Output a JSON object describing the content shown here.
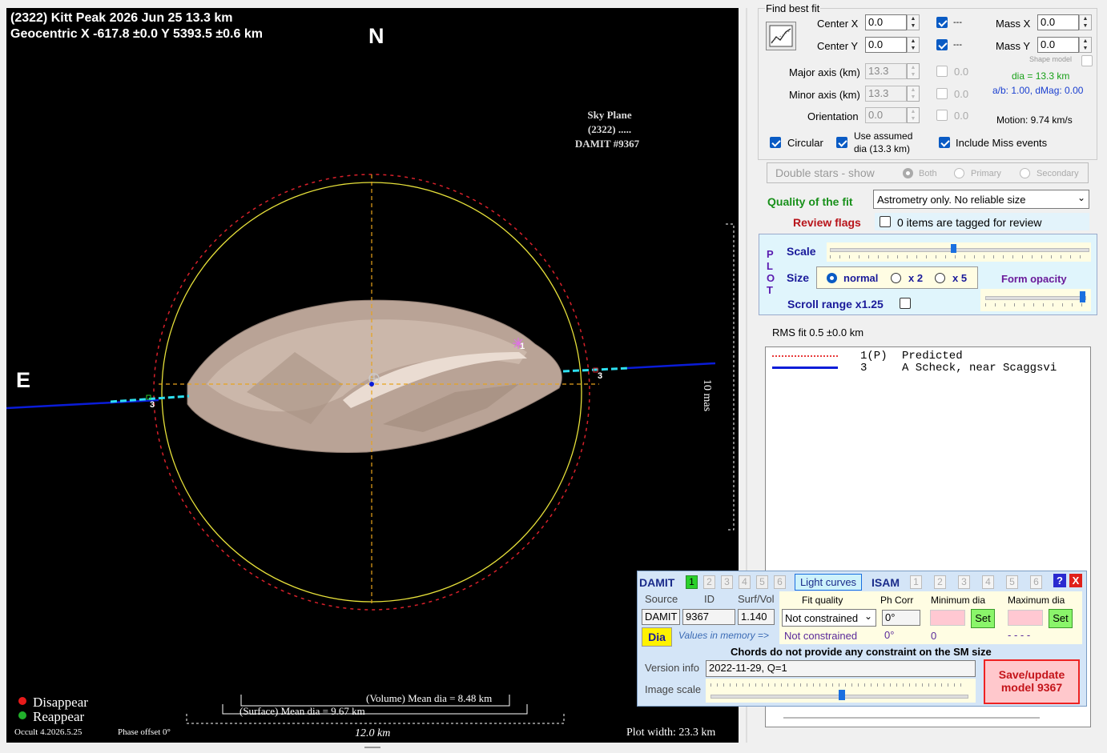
{
  "plot": {
    "title_line1": "(2322) Kitt Peak  2026 Jun 25   13.3 km",
    "title_line2": "Geocentric  X  -617.8 ±0.0  Y 5393.5 ±0.6 km",
    "north_label": "N",
    "east_label": "E",
    "sky_plane_l1": "Sky Plane",
    "sky_plane_l2": "(2322) .....",
    "sky_plane_l3": "DAMIT #9367",
    "scale_label": "10 mas",
    "chord_label_left": "3",
    "chord_label_right": "3",
    "chord_label_top": "1",
    "legend_disappear": "Disappear",
    "legend_reappear": "Reappear",
    "version": "Occult 4.2026.5.25",
    "phase_offset": "Phase offset 0°",
    "volume_mean": "(Volume) Mean dia = 8.48 km",
    "surface_mean": "(Surface) Mean dia = 9.67 km",
    "scale_bar": "12.0 km",
    "plot_width": "Plot width: 23.3 km",
    "colors": {
      "limb": "#e7e13a",
      "dashed_circle": "#d6202a",
      "chord": "#0a1cd8",
      "cyan": "#2ee0f0",
      "shape": "#c7b3a6",
      "cross": "#e8a31c"
    }
  },
  "fit": {
    "group_title": "Find best fit",
    "center_x_label": "Center X",
    "center_x": "0.0",
    "center_y_label": "Center Y",
    "center_y": "0.0",
    "center_x_dash": "---",
    "center_y_dash": "---",
    "mass_x_label": "Mass X",
    "mass_x": "0.0",
    "mass_y_label": "Mass Y",
    "mass_y": "0.0",
    "shape_model_label": "Shape model",
    "major_label": "Major axis (km)",
    "major": "13.3",
    "major_val": "0.0",
    "minor_label": "Minor axis (km)",
    "minor": "13.3",
    "minor_val": "0.0",
    "orient_label": "Orientation",
    "orient": "0.0",
    "orient_val": "0.0",
    "dia_text": "dia = 13.3 km",
    "ab_text": "a/b: 1.00, dMag: 0.00",
    "motion": "Motion: 9.74 km/s",
    "circular_label": "Circular",
    "use_assumed_l1": "Use assumed",
    "use_assumed_l2": "dia (13.3 km)",
    "include_miss": "Include Miss events"
  },
  "double": {
    "label": "Double stars - show",
    "both": "Both",
    "primary": "Primary",
    "secondary": "Secondary"
  },
  "quality": {
    "label": "Quality of the fit",
    "value": "Astrometry only. No reliable size",
    "review_label": "Review flags",
    "review_value": "0 items are tagged for review"
  },
  "plotctl": {
    "vertical": "P L O T",
    "scale_label": "Scale",
    "size_label": "Size",
    "normal": "normal",
    "x2": "x 2",
    "x5": "x 5",
    "form_opacity": "Form opacity",
    "scroll_range": "Scroll range x1.25",
    "scale_level": 0.47,
    "opacity_level": 0.95
  },
  "rms": "RMS fit 0.5 ±0.0 km",
  "legend_list": [
    {
      "num": "1(P)",
      "text": "Predicted"
    },
    {
      "num": "3",
      "text": "A Scheck, near Scaggsvi"
    }
  ],
  "damit": {
    "title": "DAMIT",
    "tabs": [
      "1",
      "2",
      "3",
      "4",
      "5",
      "6"
    ],
    "light_curves": "Light curves",
    "isam": "ISAM",
    "isam_tabs": [
      "1",
      "2",
      "3",
      "4",
      "5",
      "6"
    ],
    "help": "?",
    "close": "X",
    "source_h": "Source",
    "id_h": "ID",
    "surf_h": "Surf/Vol",
    "fit_quality_h": "Fit quality",
    "ph_corr_h": "Ph Corr",
    "min_dia_h": "Minimum dia",
    "max_dia_h": "Maximum dia",
    "source": "DAMIT",
    "id": "9367",
    "surf": "1.140",
    "fit_quality": "Not constrained",
    "ph_corr": "0°",
    "set": "Set",
    "dia_btn": "Dia",
    "values_mem": "Values in memory =>",
    "mem_fit": "Not constrained",
    "mem_ph": "0°",
    "mem_min": "0",
    "mem_max": "- - - -",
    "chords_note": "Chords do not provide any constraint on the SM size",
    "version_label": "Version info",
    "version_value": "2022-11-29, Q=1",
    "image_scale": "Image scale",
    "save_l1": "Save/update",
    "save_l2": "model 9367",
    "image_scale_level": 0.5
  }
}
